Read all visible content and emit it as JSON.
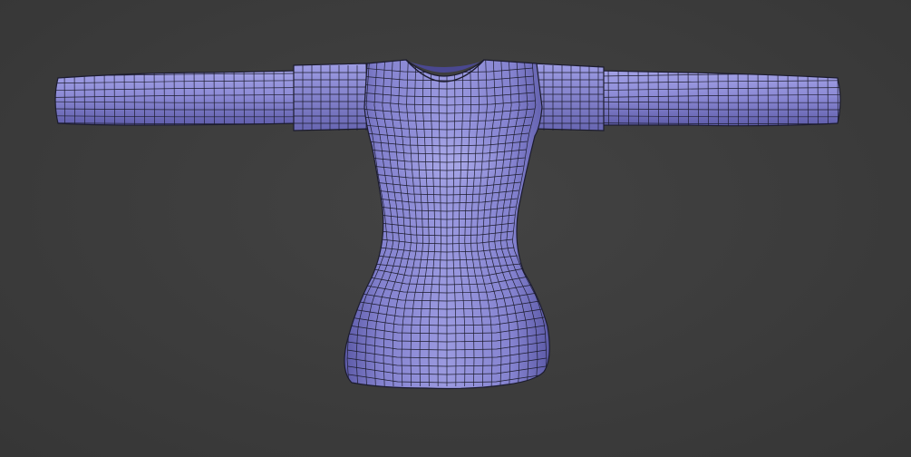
{
  "viewport": {
    "background_color": "#3a3a3a"
  },
  "model": {
    "mesh_color": "#8c8ad8",
    "mesh_highlight": "#b4b3ee",
    "mesh_shadow": "#5a58a4",
    "wire_color": "#1c1c2e"
  }
}
